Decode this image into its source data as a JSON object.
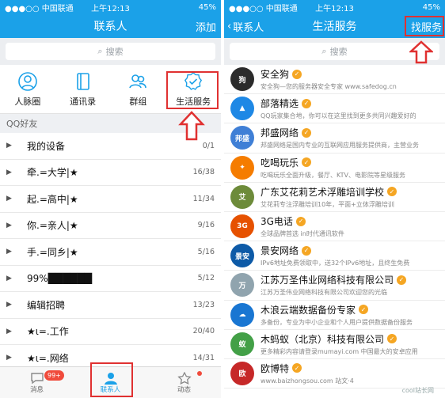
{
  "left": {
    "status": {
      "carrier": "●●●○○ 中国联通",
      "time": "上午12:13",
      "battery": "45%"
    },
    "nav": {
      "title": "联系人",
      "action": "添加"
    },
    "search_placeholder": "搜索",
    "quick_items": [
      {
        "label": "人脉圈",
        "icon": "person-circle-icon"
      },
      {
        "label": "通讯录",
        "icon": "address-book-icon"
      },
      {
        "label": "群组",
        "icon": "group-icon"
      },
      {
        "label": "生活服务",
        "icon": "verified-badge-icon"
      }
    ],
    "section": "QQ好友",
    "groups": [
      {
        "name": "我的设备",
        "count": "0/1"
      },
      {
        "name": "牵.=大学|★",
        "count": "16/38"
      },
      {
        "name": "起.=高中|★",
        "count": "11/34"
      },
      {
        "name": "你.=亲人|★",
        "count": "9/16"
      },
      {
        "name": "手.=同乡|★",
        "count": "5/16"
      },
      {
        "name": "99%██████",
        "count": "5/12"
      },
      {
        "name": "编辑招聘",
        "count": "13/23"
      },
      {
        "name": "★ι=.工作",
        "count": "20/40"
      },
      {
        "name": "★ι=.网络",
        "count": "14/31"
      }
    ],
    "tabs": [
      {
        "label": "消息",
        "badge": "99+"
      },
      {
        "label": "联系人"
      },
      {
        "label": "动态"
      }
    ]
  },
  "right": {
    "status": {
      "carrier": "●●●○○ 中国联通",
      "time": "上午12:13",
      "battery": "45%"
    },
    "nav": {
      "back": "联系人",
      "title": "生活服务",
      "action": "找服务"
    },
    "search_placeholder": "搜索",
    "services": [
      {
        "name": "安全狗",
        "desc": "安全狗—您的服务器安全专家 www.safedog.cn",
        "color": "#2b2b2b",
        "logo": "狗"
      },
      {
        "name": "部落精选",
        "desc": "QQ玩家集合地，你可以在这里找到更多共同兴趣爱好的",
        "color": "#1e88e5",
        "logo": "▲"
      },
      {
        "name": "邦盛网络",
        "desc": "邦盛网络是国内专业的互联网应用服务提供商，主营业务",
        "color": "#3f7fd6",
        "logo": "邦盛"
      },
      {
        "name": "吃喝玩乐",
        "desc": "吃喝玩乐全面升级，餐厅、KTV、电影院等星级服务",
        "color": "#f57c00",
        "logo": "✦"
      },
      {
        "name": "广东艾花莉艺术浮雕培训学校",
        "desc": "艾花莉专注浮雕培训10年，平面+立体浮雕培训",
        "color": "#6d8b3a",
        "logo": "艾"
      },
      {
        "name": "3G电话",
        "desc": "全球品牌首选 in时代通讯软件",
        "color": "#e65100",
        "logo": "3G"
      },
      {
        "name": "景安网络",
        "desc": "IPv6地址免费领取中，送32个IPv6地址，且终生免费",
        "color": "#0d5aa7",
        "logo": "景安"
      },
      {
        "name": "江苏万圣伟业网络科技有限公司",
        "desc": "江苏万圣伟业网络科技有限公司欢迎您的光临",
        "color": "#90a4ae",
        "logo": "万"
      },
      {
        "name": "木浪云端数据备份专家",
        "desc": "多备份，专业为中小企业和个人用户提供数据备份服务",
        "color": "#1976d2",
        "logo": "☁"
      },
      {
        "name": "木蚂蚁（北京）科技有限公司",
        "desc": "更多精彩内容请登录mumayi.com 中国最大的安卓应用",
        "color": "#43a047",
        "logo": "蚁"
      },
      {
        "name": "欧博特",
        "desc": "www.baizhongsou.com 站文·4",
        "color": "#c62828",
        "logo": "欧"
      }
    ],
    "watermark": "cool站长网"
  }
}
